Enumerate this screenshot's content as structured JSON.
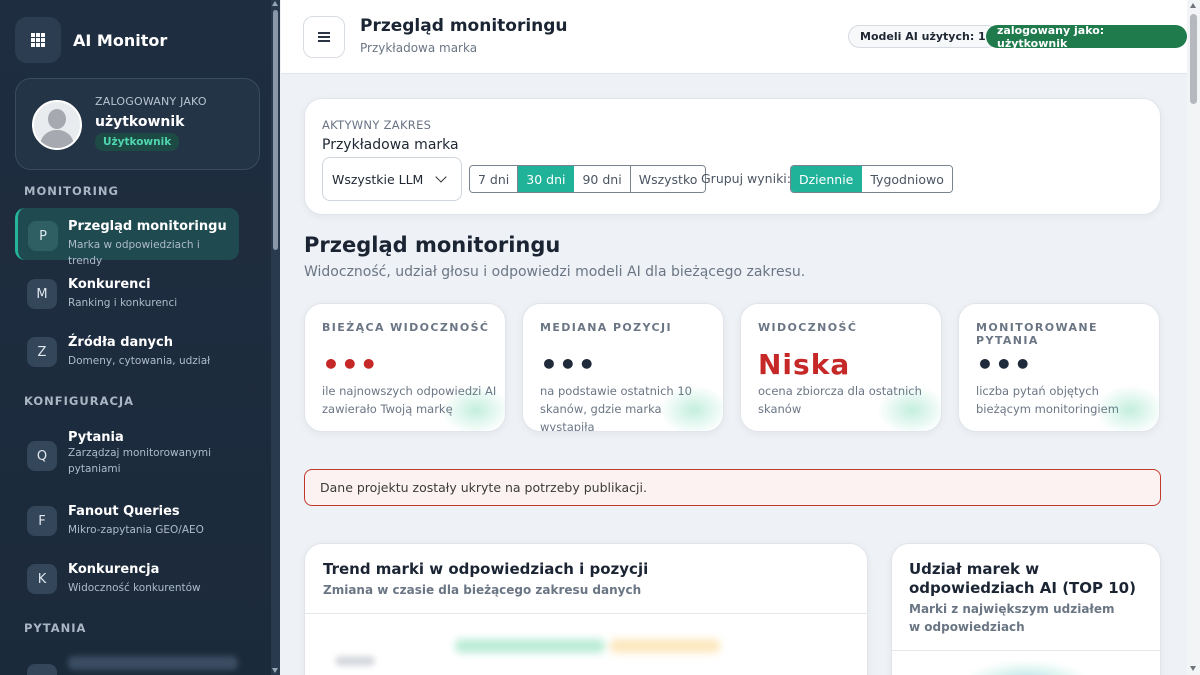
{
  "brand": {
    "name": "AI Monitor"
  },
  "user_card": {
    "label": "ZALOGOWANY JAKO",
    "name": "użytkownik",
    "role": "Użytkownik"
  },
  "sidebar": {
    "sections": [
      "MONITORING",
      "KONFIGURACJA",
      "PYTANIA"
    ],
    "items": [
      {
        "badge": "P",
        "title": "Przegląd monitoringu",
        "sub": "Marka w odpowiedziach i trendy",
        "active": true
      },
      {
        "badge": "M",
        "title": "Konkurenci",
        "sub": "Ranking i konkurenci"
      },
      {
        "badge": "Z",
        "title": "Źródła danych",
        "sub": "Domeny, cytowania, udział"
      },
      {
        "badge": "Q",
        "title": "Pytania",
        "sub": "Zarządzaj monitorowanymi pytaniami"
      },
      {
        "badge": "F",
        "title": "Fanout Queries",
        "sub": "Mikro-zapytania GEO/AEO"
      },
      {
        "badge": "K",
        "title": "Konkurencja",
        "sub": "Widoczność konkurentów"
      }
    ]
  },
  "topbar": {
    "title": "Przegląd monitoringu",
    "subtitle": "Przykładowa marka",
    "models_pill": "Modeli AI użytych: 1",
    "user_pill": "zalogowany jako: użytkownik"
  },
  "filters": {
    "label": "AKTYWNY ZAKRES",
    "brand": "Przykładowa marka",
    "llm_select": "Wszystkie LLM",
    "ranges": [
      "7 dni",
      "30 dni",
      "90 dni",
      "Wszystko"
    ],
    "selected_range": "30 dni",
    "group_label": "Grupuj wyniki:",
    "groups": [
      "Dziennie",
      "Tygodniowo"
    ],
    "selected_group": "Dziennie"
  },
  "overview": {
    "title": "Przegląd monitoringu",
    "subtitle": "Widoczność, udział głosu i odpowiedzi modeli AI dla bieżącego zakresu."
  },
  "kpis": [
    {
      "label": "BIEŻĄCA WIDOCZNOŚĆ",
      "value": "•••",
      "desc": "ile najnowszych odpowiedzi AI zawierało Twoją markę",
      "color": "#c62828"
    },
    {
      "label": "MEDIANA POZYCJI",
      "value": "•••",
      "desc": "na podstawie ostatnich 10 skanów, gdzie marka wystąpiła",
      "color": "#1f2a3a"
    },
    {
      "label": "WIDOCZNOŚĆ",
      "value": "Niska",
      "desc": "ocena zbiorcza dla ostatnich skanów",
      "color": "#c62828"
    },
    {
      "label": "MONITOROWANE PYTANIA",
      "value": "•••",
      "desc": "liczba pytań objętych bieżącym monitoringiem",
      "color": "#1f2a3a"
    }
  ],
  "alert": {
    "text": "Dane projektu zostały ukryte na potrzeby publikacji."
  },
  "trend_card": {
    "title": "Trend marki w odpowiedziach i pozycji",
    "subtitle": "Zmiana w czasie dla bieżącego zakresu danych"
  },
  "share_card": {
    "title": "Udział marek w odpowiedziach AI (TOP 10)",
    "subtitle": "Marki z największym udziałem w odpowiedziach"
  },
  "colors": {
    "accent": "#20b39a",
    "sidebar_bg": "#1f2d40",
    "user_pill": "#1f7a4c",
    "alert_border": "#c0392b"
  }
}
